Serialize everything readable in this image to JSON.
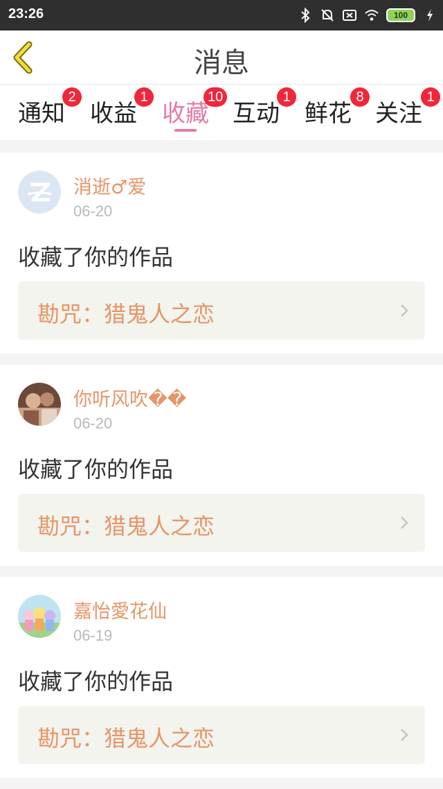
{
  "status": {
    "time": "23:26",
    "battery": "100"
  },
  "header": {
    "title": "消息"
  },
  "tabs": [
    {
      "label": "通知",
      "badge": "2"
    },
    {
      "label": "收益",
      "badge": "1"
    },
    {
      "label": "收藏",
      "badge": "10"
    },
    {
      "label": "互动",
      "badge": "1"
    },
    {
      "label": "鲜花",
      "badge": "8"
    },
    {
      "label": "关注",
      "badge": "1"
    }
  ],
  "messages": [
    {
      "username": "消逝♂爱",
      "date": "06-20",
      "action": "收藏了你的作品",
      "work": "勘咒：猎鬼人之恋",
      "avatar": "qq-default-avatar"
    },
    {
      "username": "你听风吹��",
      "date": "06-20",
      "action": "收藏了你的作品",
      "work": "勘咒：猎鬼人之恋",
      "avatar": "photo-avatar"
    },
    {
      "username": "嘉怡愛花仙",
      "date": "06-19",
      "action": "收藏了你的作品",
      "work": "勘咒：猎鬼人之恋",
      "avatar": "cartoon-avatar"
    }
  ],
  "colors": {
    "accent": "#e67aa7",
    "name": "#e69567",
    "badge": "#f0263a"
  }
}
